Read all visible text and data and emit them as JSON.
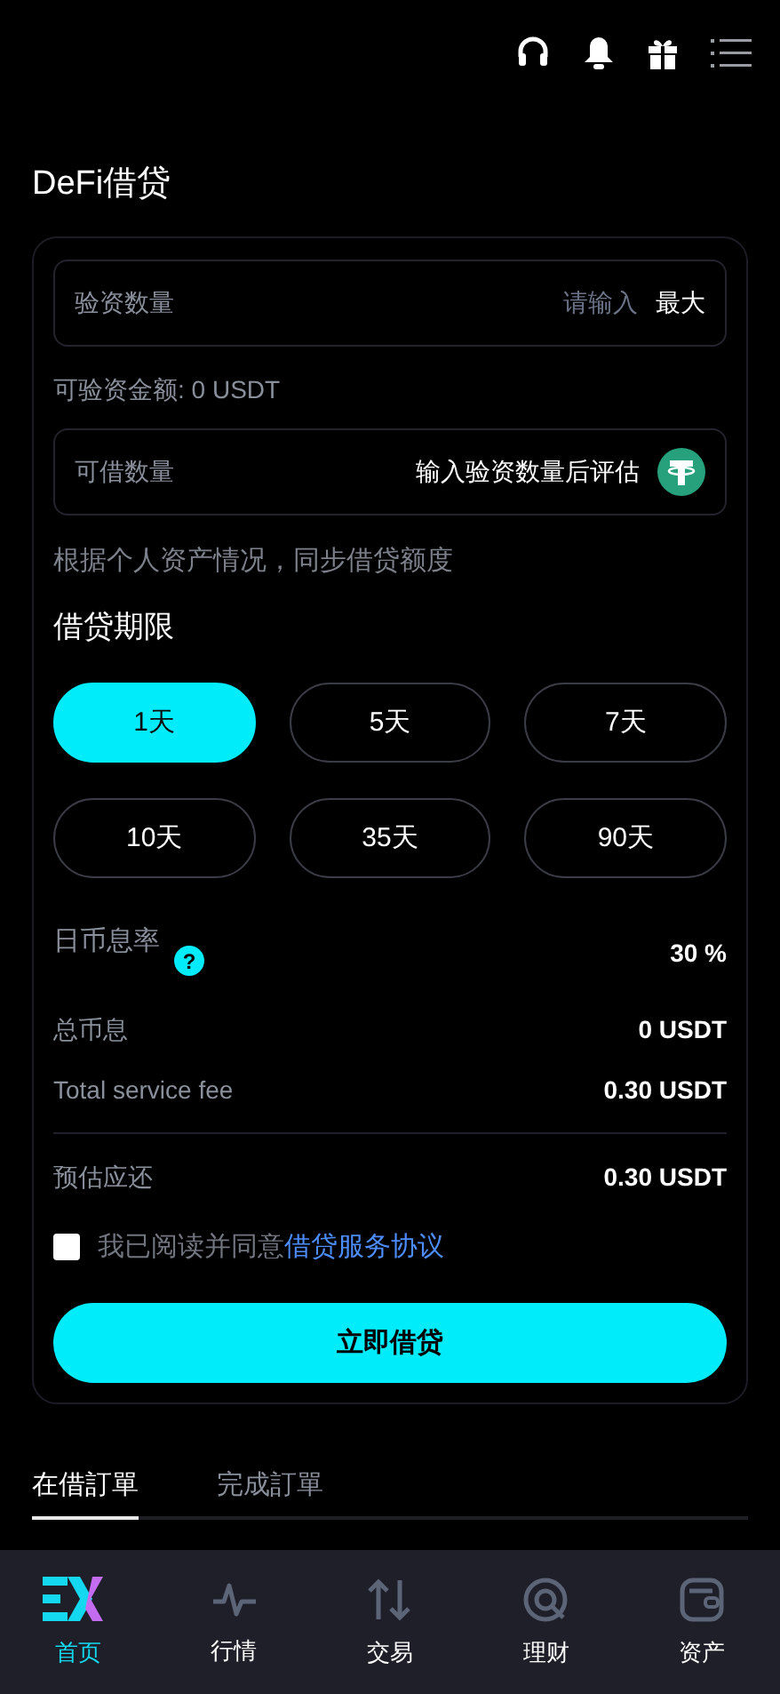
{
  "page_title": "DeFi借贷",
  "collateral_field": {
    "label": "验资数量",
    "placeholder": "请输入",
    "max_button": "最大"
  },
  "available": "可验资金额: 0 USDT",
  "borrow_field": {
    "label": "可借数量",
    "value": "输入验资数量后评估"
  },
  "note": "根据个人资产情况，同步借贷额度",
  "term_title": "借贷期限",
  "terms": [
    {
      "label": "1天",
      "selected": true
    },
    {
      "label": "5天",
      "selected": false
    },
    {
      "label": "7天",
      "selected": false
    },
    {
      "label": "10天",
      "selected": false
    },
    {
      "label": "35天",
      "selected": false
    },
    {
      "label": "90天",
      "selected": false
    }
  ],
  "rate": {
    "label": "日币息率",
    "help": "?",
    "value": "30 %"
  },
  "summary": [
    {
      "label": "总币息",
      "value": "0 USDT"
    },
    {
      "label": "Total service fee",
      "value": "0.30 USDT"
    }
  ],
  "repay": {
    "label": "预估应还",
    "value": "0.30 USDT"
  },
  "agreement": {
    "checked": false,
    "text": "我已阅读并同意",
    "link": "借贷服务协议"
  },
  "submit": "立即借贷",
  "order_tabs": [
    {
      "label": "在借訂單",
      "selected": true
    },
    {
      "label": "完成訂單",
      "selected": false
    }
  ],
  "nav": [
    {
      "label": "首页",
      "kind": "home",
      "selected": true
    },
    {
      "label": "行情",
      "kind": "market",
      "selected": false
    },
    {
      "label": "交易",
      "kind": "trade",
      "selected": false
    },
    {
      "label": "理财",
      "kind": "finance",
      "selected": false
    },
    {
      "label": "资产",
      "kind": "assets",
      "selected": false
    }
  ]
}
